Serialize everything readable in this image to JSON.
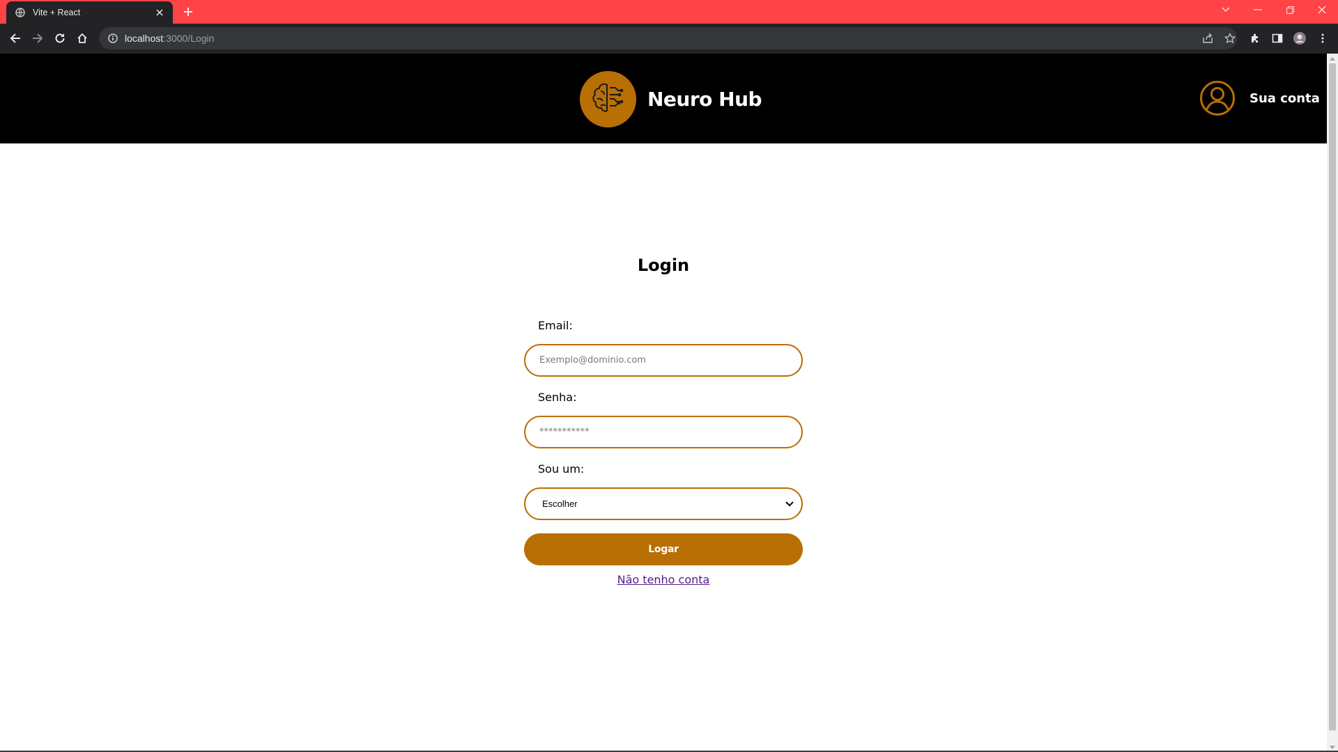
{
  "browser": {
    "tab_title": "Vite + React",
    "url_host": "localhost",
    "url_rest": ":3000/Login",
    "tabstrip_color": "#ff4347"
  },
  "header": {
    "brand_name": "Neuro Hub",
    "account_label": "Sua conta",
    "logo_icon": "brain-circuit-icon",
    "accent_color": "#b86f04"
  },
  "login": {
    "title": "Login",
    "email_label": "Email:",
    "email_placeholder": "Exemplo@dominio.com",
    "password_label": "Senha:",
    "password_placeholder": "***********",
    "role_label": "Sou um:",
    "role_selected": "Escolher",
    "submit_label": "Logar",
    "register_link": "Não tenho conta"
  }
}
